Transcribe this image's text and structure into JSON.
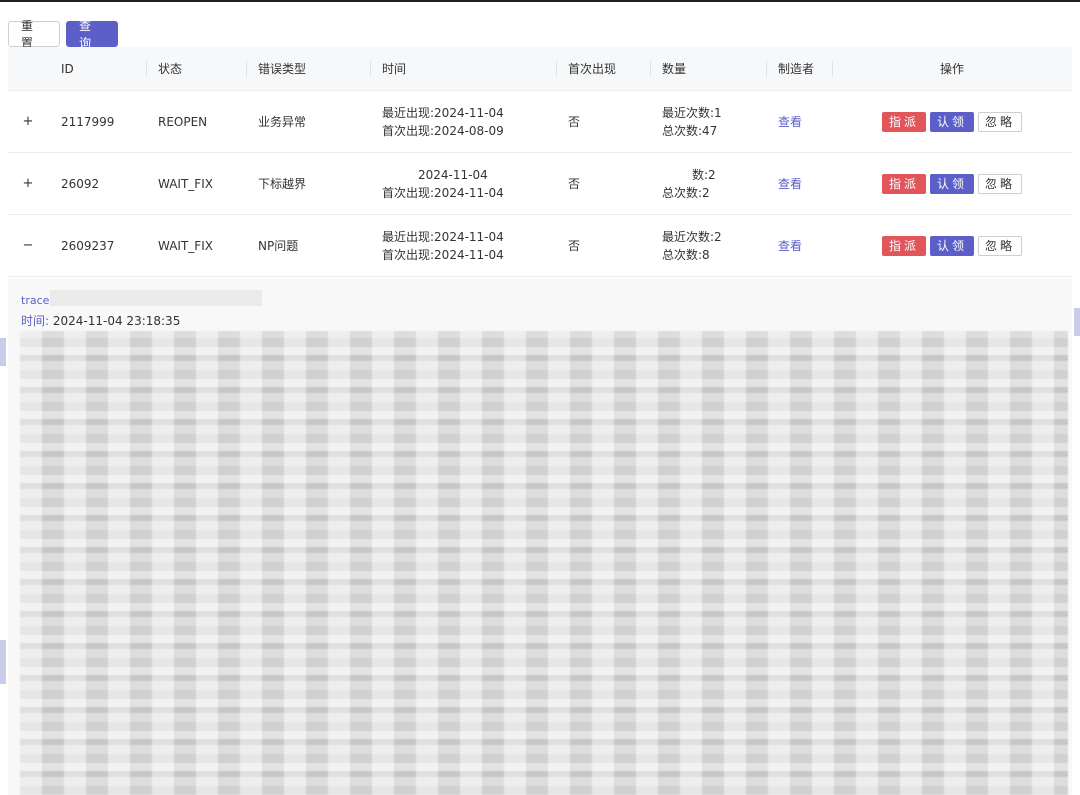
{
  "toolbar": {
    "reset_label": "重 置",
    "query_label": "查 询"
  },
  "table": {
    "headers": {
      "id": "ID",
      "status": "状态",
      "type": "错误类型",
      "time": "时间",
      "first": "首次出现",
      "count": "数量",
      "maker": "制造者",
      "ops": "操作"
    },
    "rows": [
      {
        "expander": "+",
        "id": "2117999",
        "status": "REOPEN",
        "type": "业务异常",
        "recent_time": "最近出现:2024-11-04",
        "first_time": "首次出现:2024-08-09",
        "first": "否",
        "recent_count": "最近次数:1",
        "total_count": "总次数:47",
        "maker": "查看"
      },
      {
        "expander": "+",
        "id": "26092",
        "status": "WAIT_FIX",
        "type": "下标越界",
        "recent_time": "2024-11-04",
        "first_time": "首次出现:2024-11-04",
        "first": "否",
        "recent_count": "数:2",
        "total_count": "总次数:2",
        "maker": "查看"
      },
      {
        "expander": "−",
        "id": "2609237",
        "status": "WAIT_FIX",
        "type": "NP问题",
        "recent_time": "最近出现:2024-11-04",
        "first_time": "首次出现:2024-11-04",
        "first": "否",
        "recent_count": "最近次数:2",
        "total_count": "总次数:8",
        "maker": "查看"
      }
    ],
    "ops": {
      "assign": "指派",
      "claim": "认领",
      "ignore": "忽略"
    }
  },
  "detail": {
    "trace_label": "trace",
    "time_key": "时间:",
    "time_value": "2024-11-04 23:18:35"
  },
  "colors": {
    "primary": "#5b5fc7",
    "danger": "#e0565b"
  }
}
